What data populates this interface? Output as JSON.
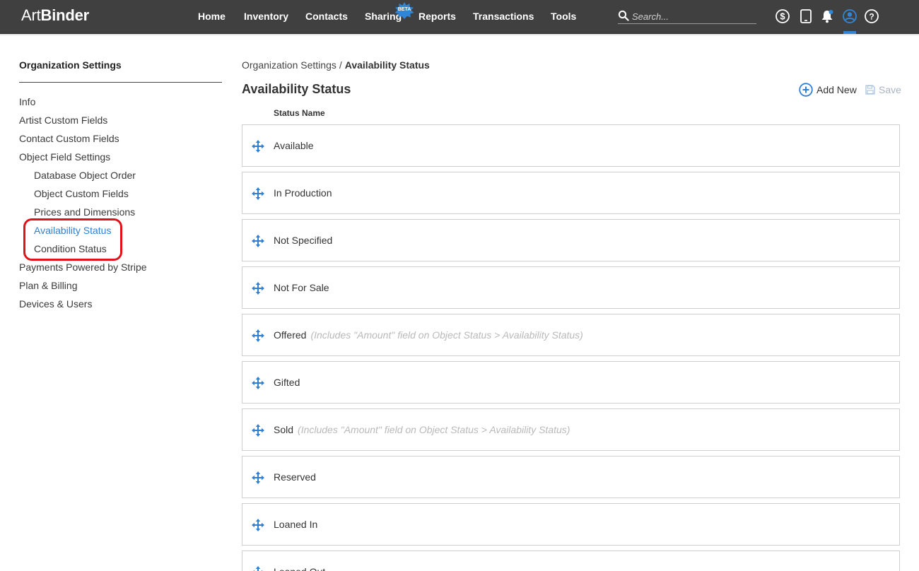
{
  "app": {
    "logo_light": "Art",
    "logo_bold": "Binder"
  },
  "nav": {
    "items": [
      "Home",
      "Inventory",
      "Contacts",
      "Sharing",
      "Reports",
      "Transactions",
      "Tools"
    ],
    "beta_badge": "BETA",
    "search_placeholder": "Search...",
    "icons": [
      "dollar-icon",
      "tablet-icon",
      "bell-icon",
      "user-icon",
      "help-icon"
    ],
    "active_icon": "user-icon",
    "accent_color": "#2f86d8"
  },
  "sidebar": {
    "title": "Organization Settings",
    "items": [
      {
        "label": "Info",
        "level": 0
      },
      {
        "label": "Artist Custom Fields",
        "level": 0
      },
      {
        "label": "Contact Custom Fields",
        "level": 0
      },
      {
        "label": "Object Field Settings",
        "level": 0
      },
      {
        "label": "Database Object Order",
        "level": 1
      },
      {
        "label": "Object Custom Fields",
        "level": 1
      },
      {
        "label": "Prices and Dimensions",
        "level": 1
      },
      {
        "label": "Availability Status",
        "level": 1,
        "active": true
      },
      {
        "label": "Condition Status",
        "level": 1
      },
      {
        "label": "Payments Powered by Stripe",
        "level": 0
      },
      {
        "label": "Plan & Billing",
        "level": 0
      },
      {
        "label": "Devices & Users",
        "level": 0
      }
    ],
    "highlight_color": "#e0131b"
  },
  "main": {
    "breadcrumb": {
      "parent": "Organization Settings",
      "separator": "/",
      "current": "Availability Status"
    },
    "title": "Availability Status",
    "add_new_label": "Add New",
    "save_label": "Save",
    "column_header": "Status Name",
    "statuses": [
      {
        "name": "Available",
        "note": ""
      },
      {
        "name": "In Production",
        "note": ""
      },
      {
        "name": "Not Specified",
        "note": ""
      },
      {
        "name": "Not For Sale",
        "note": ""
      },
      {
        "name": "Offered",
        "note": "(Includes \"Amount\" field on Object Status > Availability Status)"
      },
      {
        "name": "Gifted",
        "note": ""
      },
      {
        "name": "Sold",
        "note": "(Includes \"Amount\" field on Object Status > Availability Status)"
      },
      {
        "name": "Reserved",
        "note": ""
      },
      {
        "name": "Loaned In",
        "note": ""
      },
      {
        "name": "Loaned Out",
        "note": ""
      }
    ]
  }
}
